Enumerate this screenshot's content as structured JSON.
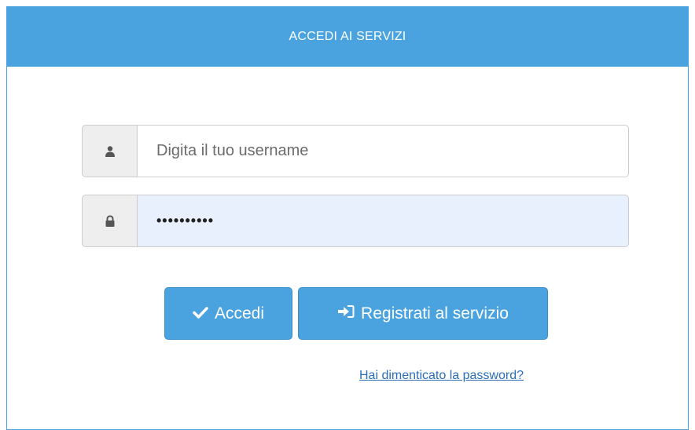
{
  "header": {
    "title": "ACCEDI AI SERVIZI"
  },
  "login": {
    "username": {
      "placeholder": "Digita il tuo username",
      "value": "",
      "icon": "user-icon"
    },
    "password": {
      "value": "••••••••••",
      "icon": "lock-icon"
    }
  },
  "actions": {
    "accedi_label": "Accedi",
    "accedi_icon": "checkmark-icon",
    "registrati_label": "Registrati al servizio",
    "registrati_icon": "sign-in-icon",
    "forgot_password": "Hai dimenticato la password?"
  },
  "colors": {
    "primary": "#4aa3df",
    "link": "#2a6eb8",
    "autofill_bg": "#e8f0fe"
  }
}
